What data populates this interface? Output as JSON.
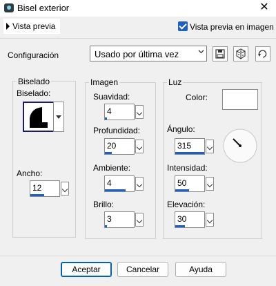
{
  "window": {
    "title": "Bisel exterior"
  },
  "preview": {
    "toggle_label": "Vista previa",
    "checkbox_label": "Vista previa en imagen",
    "checked": true
  },
  "config": {
    "label": "Configuración",
    "selected": "Usado por última vez"
  },
  "biselado": {
    "group_title": "Biselado",
    "shape_label": "Biselado:",
    "width_label": "Ancho:",
    "width_value": "12"
  },
  "imagen": {
    "group_title": "Imagen",
    "suavidad_label": "Suavidad:",
    "suavidad": "4",
    "profundidad_label": "Profundidad:",
    "profundidad": "20",
    "ambiente_label": "Ambiente:",
    "ambiente": "4",
    "brillo_label": "Brillo:",
    "brillo": "3"
  },
  "luz": {
    "group_title": "Luz",
    "color_label": "Color:",
    "color_value": "#ffffff",
    "angulo_label": "Ángulo:",
    "angulo": "315",
    "intensidad_label": "Intensidad:",
    "intensidad": "50",
    "elevacion_label": "Elevación:",
    "elevacion": "30"
  },
  "buttons": {
    "ok": "Aceptar",
    "cancel": "Cancelar",
    "help": "Ayuda"
  },
  "accent": "#1f5fbf"
}
